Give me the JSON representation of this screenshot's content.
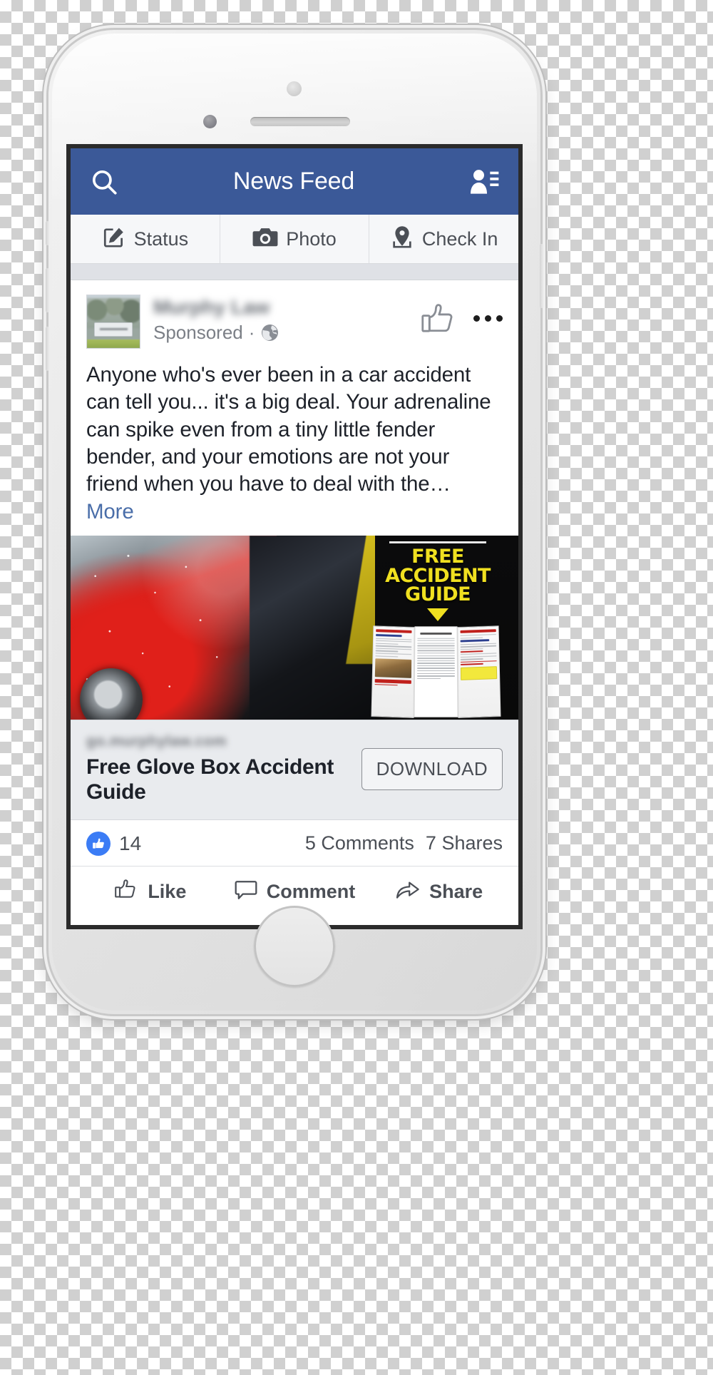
{
  "navbar": {
    "title": "News Feed",
    "search_icon": "search-icon",
    "friend_requests_icon": "friend-requests-icon"
  },
  "composer": {
    "items": [
      {
        "label": "Status",
        "icon": "status-compose-icon"
      },
      {
        "label": "Photo",
        "icon": "camera-icon"
      },
      {
        "label": "Check In",
        "icon": "location-pin-icon"
      }
    ]
  },
  "post": {
    "author_name": "Murphy Law",
    "sponsored_label": "Sponsored",
    "separator": "·",
    "privacy_icon": "globe-icon",
    "like_icon": "thumbs-up-outline-icon",
    "menu_icon": "overflow-menu-icon",
    "body_text": "Anyone who's ever been in a car accident can tell you... it's a big deal. Your adrenaline can spike even from a tiny little fender bender, and your emotions are not your friend when you have to deal with the…",
    "more_label": "More",
    "ad_image": {
      "headline_line1": "FREE",
      "headline_line2": "ACCIDENT",
      "headline_line3": "GUIDE",
      "arrow_icon": "down-triangle-icon",
      "alt": "car-crash-photo"
    },
    "link_card": {
      "domain": "go.murphylaw.com",
      "title": "Free Glove Box Accident Guide",
      "cta_label": "DOWNLOAD"
    },
    "stats": {
      "reaction_icon": "like-reaction-badge",
      "reaction_count": "14",
      "comments": "5 Comments",
      "shares": "7 Shares"
    },
    "actions": [
      {
        "label": "Like",
        "icon": "thumbs-up-outline-icon"
      },
      {
        "label": "Comment",
        "icon": "comment-bubble-icon"
      },
      {
        "label": "Share",
        "icon": "share-arrow-icon"
      }
    ]
  },
  "colors": {
    "facebook_blue": "#3b5998",
    "reaction_blue": "#3b7cf5",
    "link_blue": "#4a6ea9",
    "ad_yellow": "#f0e020",
    "text_dark": "#1d2129",
    "text_muted": "#4b4f56"
  }
}
